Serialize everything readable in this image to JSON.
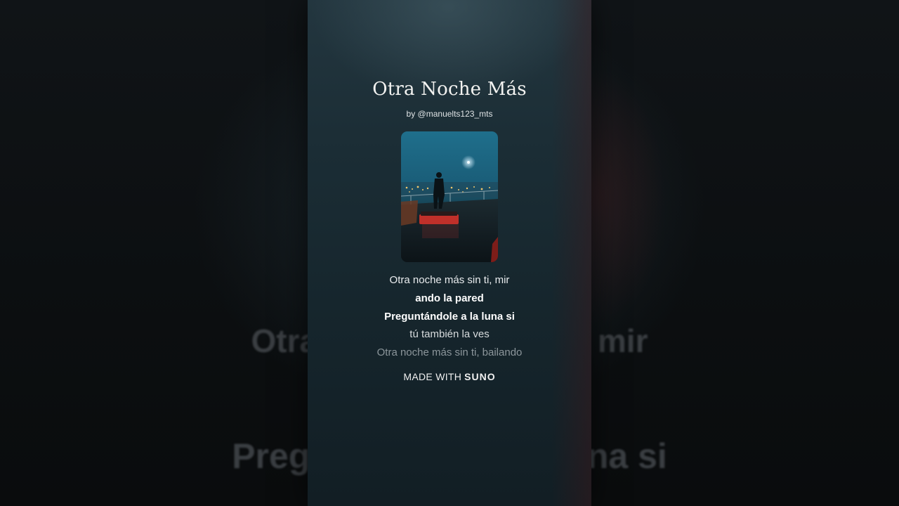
{
  "background": {
    "blurred_line_1": "Otra noche más sin ti, mir",
    "blurred_line_2": "Preguntándole a la luna si"
  },
  "song": {
    "title": "Otra Noche Más",
    "byline": "by @manuelts123_mts"
  },
  "lyrics": [
    "Otra noche más sin ti, mir",
    "ando la pared",
    "Preguntándole a la luna si",
    "tú también la ves",
    "Otra noche más sin ti, bailando"
  ],
  "footer": {
    "prefix": "MADE WITH",
    "brand": "SUNO"
  },
  "colors": {
    "frame_top": "#23363f",
    "frame_bottom": "#121e24",
    "cover_sky": "#1f6f8c",
    "city_lights": "#f2c66b",
    "accent_red": "#c0302a"
  }
}
